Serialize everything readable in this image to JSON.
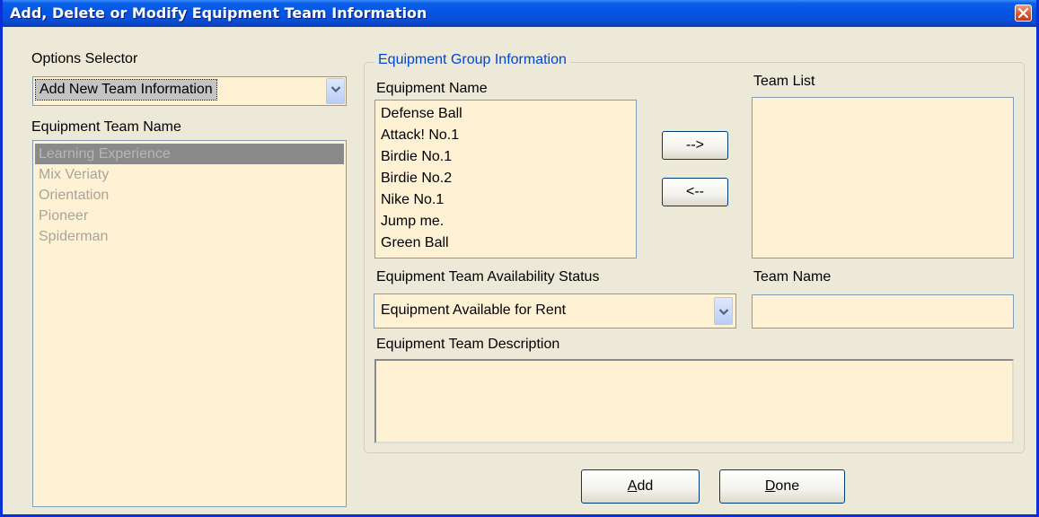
{
  "window": {
    "title": "Add, Delete or Modify Equipment Team Information"
  },
  "options": {
    "label": "Options Selector",
    "selected": "Add New Team Information"
  },
  "team_names": {
    "label": "Equipment Team Name",
    "items": [
      "Learning Experience",
      "Mix Veriaty",
      "Orientation",
      "Pioneer",
      "Spiderman"
    ]
  },
  "group": {
    "title": "Equipment Group Information",
    "equipment_label": "Equipment Name",
    "equipment_items": [
      "Defense Ball",
      "Attack! No.1",
      "Birdie No.1",
      "Birdie No.2",
      "Nike No.1",
      "Jump me.",
      "Green Ball"
    ],
    "add_arrow": "-->",
    "remove_arrow": "<--",
    "team_list_label": "Team List",
    "team_list_items": [],
    "status_label": "Equipment Team Availability Status",
    "status_selected": "Equipment Available for Rent",
    "team_name_label": "Team Name",
    "team_name_value": "",
    "description_label": "Equipment Team Description",
    "description_value": ""
  },
  "buttons": {
    "add": "Add",
    "done": "Done"
  },
  "icons": {
    "close": "close-icon",
    "dropdown": "chevron-down-icon"
  },
  "colors": {
    "field_bg": "#fff2d4",
    "titlebar": "#0554e3",
    "window_bg": "#ece9d8",
    "group_title": "#0046d5"
  }
}
